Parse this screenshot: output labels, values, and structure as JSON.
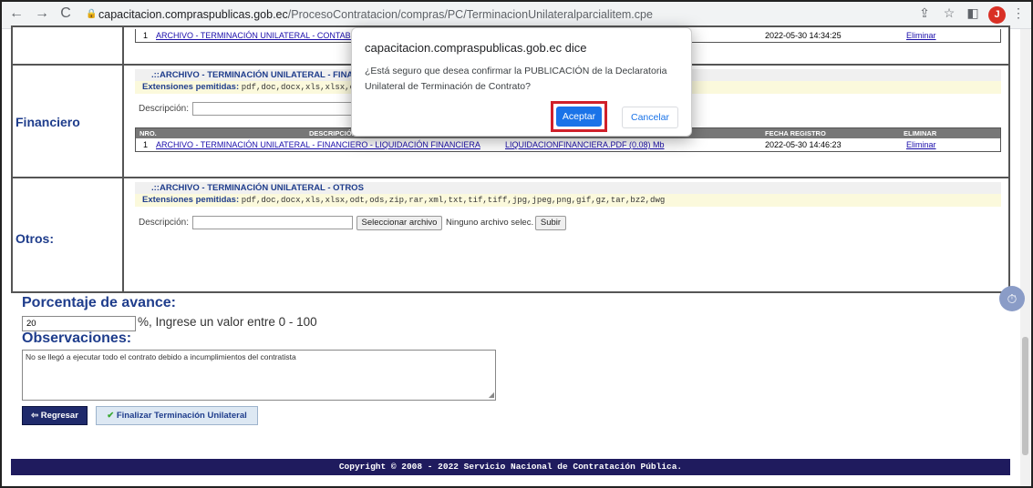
{
  "browser": {
    "back": "←",
    "forward": "→",
    "reload": "C",
    "url_domain": "capacitacion.compraspublicas.gob.ec",
    "url_path": "/ProcesoContratacion/compras/PC/TerminacionUnilateralparcialitem.cpe",
    "profile_initial": "J"
  },
  "top_partial_row": {
    "nro": "1",
    "archivo": "ARCHIVO - TERMINACIÓN UNILATERAL - CONTAB...",
    "fecha": "2022-05-30 14:34:25",
    "eliminar": "Eliminar"
  },
  "financiero": {
    "label": "Financiero",
    "file_title": ".::ARCHIVO - TERMINACIÓN UNILATERAL - FINA",
    "ext_label": "Extensiones pemitidas:",
    "ext_values": "pdf,doc,docx,xls,xlsx,o",
    "desc_label": "Descripción:",
    "table": {
      "headers": [
        "NRO.",
        "DESCRIPCIÓN",
        "FECHA REGISTRO",
        "ELIMINAR"
      ],
      "rows": [
        {
          "nro": "1",
          "descripcion": "ARCHIVO - TERMINACIÓN UNILATERAL - FINANCIERO - LIQUIDACIÓN FINANCIERA",
          "archivo": "LIQUIDACIONFINANCIERA.PDF (0.08) Mb",
          "fecha": "2022-05-30 14:46:23",
          "eliminar": "Eliminar"
        }
      ]
    }
  },
  "otros": {
    "label": "Otros:",
    "file_title": ".::ARCHIVO - TERMINACIÓN UNILATERAL - OTROS",
    "ext_label": "Extensiones pemitidas:",
    "ext_values": "pdf,doc,docx,xls,xlsx,odt,ods,zip,rar,xml,txt,tif,tiff,jpg,jpeg,png,gif,gz,tar,bz2,dwg",
    "desc_label": "Descripción:",
    "select_file": "Seleccionar archivo",
    "no_file": "Ninguno archivo selec.",
    "upload": "Subir"
  },
  "avance": {
    "heading": "Porcentaje de avance:",
    "value": "20",
    "hint": "%, Ingrese un valor entre 0 - 100"
  },
  "observaciones": {
    "heading": "Observaciones:",
    "value": "No se llegó a ejecutar todo el contrato debido a incumplimientos del contratista"
  },
  "buttons": {
    "back": "Regresar",
    "finish": "Finalizar Terminación Unilateral"
  },
  "footer": "Copyright © 2008 - 2022 Servicio Nacional de Contratación Pública.",
  "dialog": {
    "title": "capacitacion.compraspublicas.gob.ec dice",
    "message": "¿Está seguro que desea confirmar la PUBLICACIÓN de la Declaratoria Unilateral de Terminación de Contrato?",
    "ok": "Aceptar",
    "cancel": "Cancelar"
  },
  "colors": {
    "accent": "#1a73e8",
    "highlight_border": "#d0202a",
    "section_label": "#1f3d8c",
    "footer_bg": "#1f1b5e"
  }
}
